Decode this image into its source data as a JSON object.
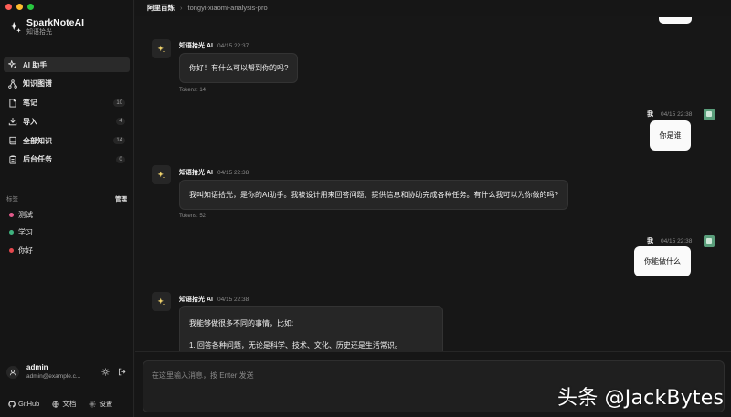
{
  "app": {
    "name": "SparkNoteAI",
    "subtitle": "知语拾光"
  },
  "nav": [
    {
      "label": "AI 助手",
      "icon": "sparkles-icon",
      "count": null,
      "active": true
    },
    {
      "label": "知识图谱",
      "icon": "graph-icon",
      "count": null
    },
    {
      "label": "笔记",
      "icon": "note-icon",
      "count": "10"
    },
    {
      "label": "导入",
      "icon": "import-icon",
      "count": "4"
    },
    {
      "label": "全部知识",
      "icon": "book-icon",
      "count": "14"
    },
    {
      "label": "后台任务",
      "icon": "clipboard-icon",
      "count": "0"
    }
  ],
  "tags_section": {
    "title": "标签",
    "manage": "管理"
  },
  "tags": [
    {
      "label": "测试",
      "color": "#e05a8a"
    },
    {
      "label": "学习",
      "color": "#3fb37f"
    },
    {
      "label": "你好",
      "color": "#e5484d"
    }
  ],
  "user": {
    "name": "admin",
    "email": "admin@example.c..."
  },
  "footer": {
    "github": "GitHub",
    "docs": "文档",
    "settings": "设置"
  },
  "breadcrumb": {
    "provider": "阿里百炼",
    "model": "tongyi-xiaomi-analysis-pro"
  },
  "messages": [
    {
      "role": "assistant",
      "name": "知语拾光 AI",
      "time": "04/15 22:37",
      "text": "你好！有什么可以帮到你的吗?",
      "tokens": "Tokens: 14"
    },
    {
      "role": "user",
      "name": "我",
      "time": "04/15 22:38",
      "text": "你是谁"
    },
    {
      "role": "assistant",
      "name": "知语拾光 AI",
      "time": "04/15 22:38",
      "text": "我叫知语拾光，是你的AI助手。我被设计用来回答问题、提供信息和协助完成各种任务。有什么我可以为你做的吗?",
      "tokens": "Tokens: 52"
    },
    {
      "role": "user",
      "name": "我",
      "time": "04/15 22:38",
      "text": "你能做什么"
    },
    {
      "role": "assistant",
      "name": "知语拾光 AI",
      "time": "04/15 22:38",
      "line1": "我能够做很多不同的事情，比如:",
      "line2": "1. 回答各种问题，无论是科学、技术、文化、历史还是生活常识。"
    }
  ],
  "composer": {
    "placeholder": "在这里输入消息，按 Enter 发送"
  },
  "watermark": "头条 @JackBytes",
  "colors": {
    "traffic_red": "#ff5f57",
    "traffic_yellow": "#febc2e",
    "traffic_green": "#28c840",
    "accent_ai": "#f5d76e"
  }
}
